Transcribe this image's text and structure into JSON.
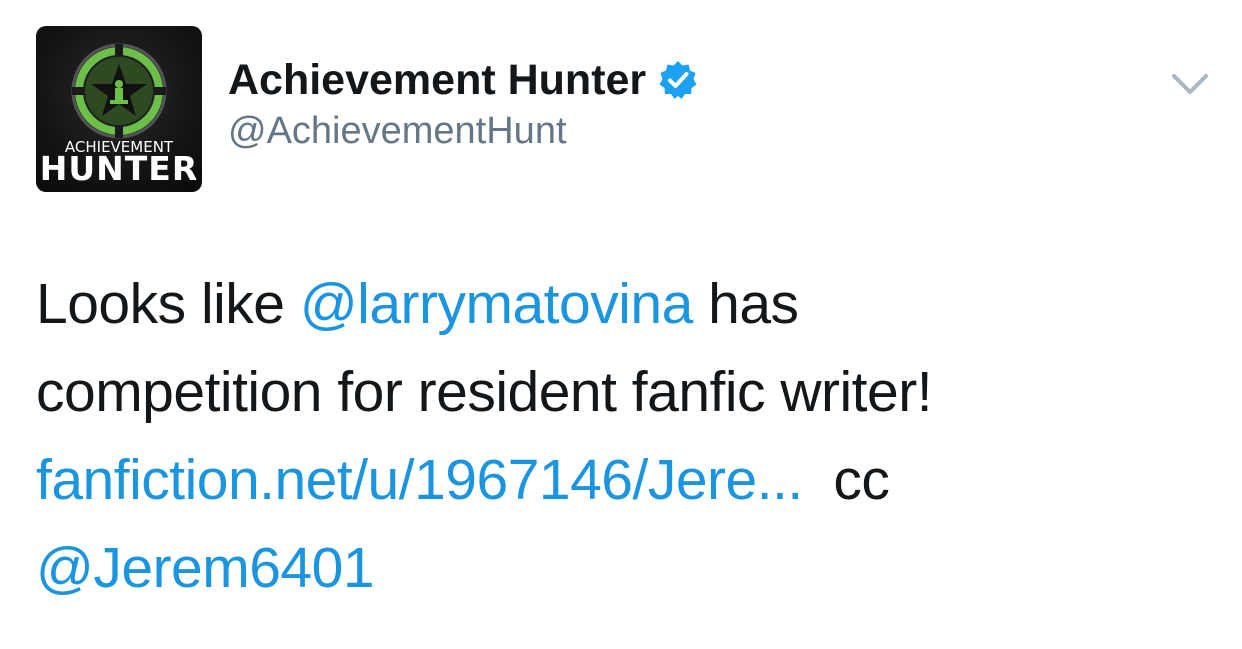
{
  "tweet": {
    "display_name": "Achievement Hunter",
    "handle": "@AchievementHunt",
    "avatar": {
      "text_top": "ACHIEVEMENT",
      "text_bottom": "HUNTER",
      "ring_color": "#6cc04a"
    },
    "verified_color": "#1da1f2",
    "body": {
      "line1_pre": "Looks like ",
      "mention1": "@larrymatovina",
      "line1_post": " has",
      "line2": "competition for resident fanfic writer!",
      "link": "fanfiction.net/u/1967146/Jere...",
      "line3_post": "  cc",
      "mention2": "@Jerem6401"
    },
    "colors": {
      "link": "#1b95e0",
      "text": "#14171a",
      "secondary": "#657786"
    }
  }
}
